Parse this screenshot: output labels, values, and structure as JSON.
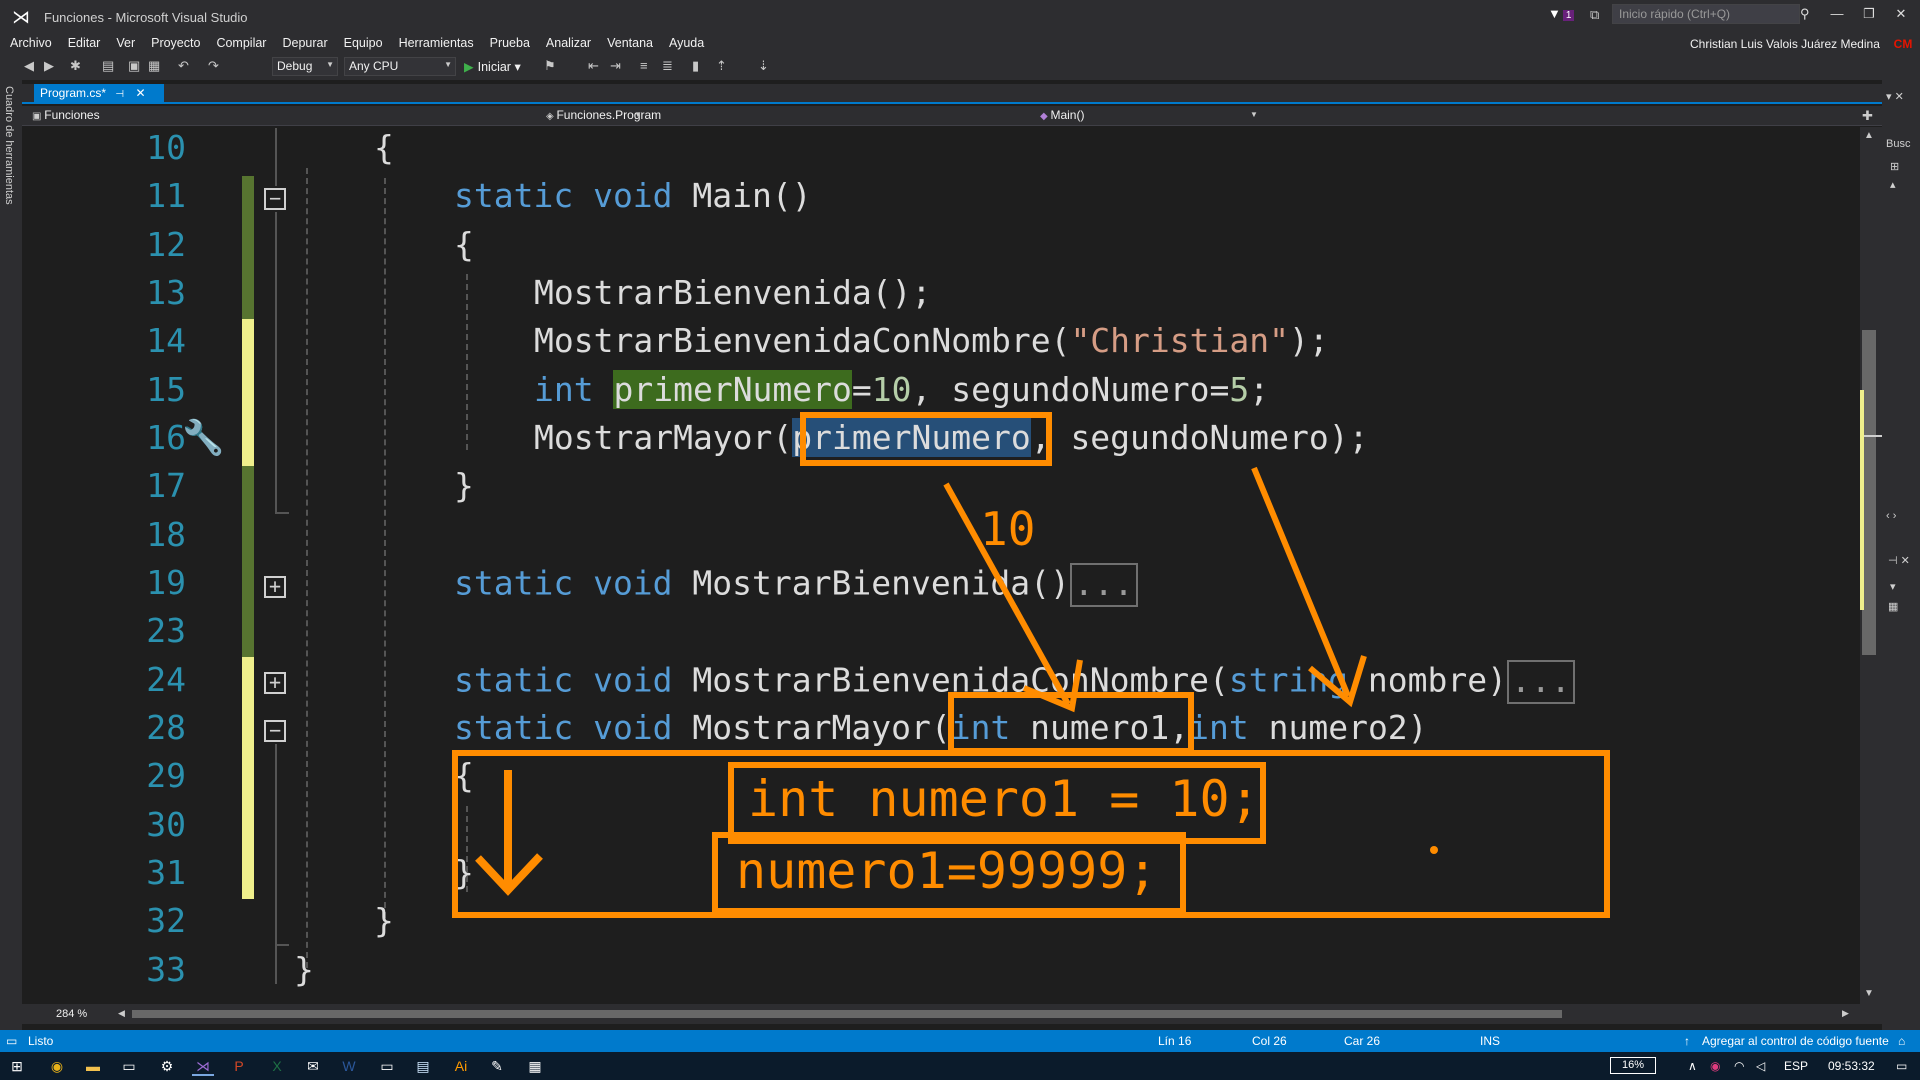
{
  "window": {
    "title": "Funciones - Microsoft Visual Studio",
    "notifications_count": "1",
    "quick_launch_placeholder": "Inicio rápido (Ctrl+Q)",
    "user_name": "Christian Luis Valois Juárez Medina",
    "user_initials": "CM"
  },
  "menu": [
    "Archivo",
    "Editar",
    "Ver",
    "Proyecto",
    "Compilar",
    "Depurar",
    "Equipo",
    "Herramientas",
    "Prueba",
    "Analizar",
    "Ventana",
    "Ayuda"
  ],
  "toolbar": {
    "configuration": "Debug",
    "platform": "Any CPU",
    "start_label": "Iniciar"
  },
  "side": {
    "toolbox_label": "Cuadro de herramientas",
    "search_label": "Busc"
  },
  "tab": {
    "label": "Program.cs*"
  },
  "nav": {
    "project": "Funciones",
    "class": "Funciones.Program",
    "member": "Main()"
  },
  "editor": {
    "line_numbers": [
      "10",
      "11",
      "12",
      "13",
      "14",
      "15",
      "16",
      "17",
      "18",
      "19",
      "23",
      "24",
      "28",
      "29",
      "30",
      "31",
      "32",
      "33"
    ],
    "code": {
      "l10": "{",
      "l11_kw": "static void",
      "l11_rest": " Main()",
      "l12": "{",
      "l13": "MostrarBienvenida();",
      "l14_a": "MostrarBienvenidaConNombre(",
      "l14_str": "\"Christian\"",
      "l14_b": ");",
      "l15_kw": "int",
      "l15_var": "primerNumero",
      "l15_eq": "=",
      "l15_num1": "10",
      "l15_mid": ", segundoNumero=",
      "l15_num2": "5",
      "l15_end": ";",
      "l16_a": "MostrarMayor(",
      "l16_sel": "primerNumero",
      "l16_b": ", segundoNumero);",
      "l17": "}",
      "l19_kw": "static void",
      "l19_rest": " MostrarBienvenida()",
      "l24_kw": "static void",
      "l24_rest": " MostrarBienvenidaConNombre(",
      "l24_kw2": "string",
      "l24_end": " nombre)",
      "l28_kw": "static void",
      "l28_rest": " MostrarMayor(",
      "l28_kw2": "int",
      "l28_p1": " numero1,",
      "l28_kw3": "int",
      "l28_p2": " numero2)",
      "l29": "{",
      "l31": "}",
      "l32": "}",
      "l33": "}",
      "ellipsis": "..."
    },
    "zoom": "284 %"
  },
  "annotations": {
    "value_label": "10",
    "assign_line": "int numero1 = 10;",
    "reassign_line": "numero1=99999;",
    "color": "#ff8c00"
  },
  "status": {
    "state": "Listo",
    "line": "Lín 16",
    "col": "Col 26",
    "char": "Car 26",
    "mode": "INS",
    "source_control": "Agregar al control de código fuente"
  },
  "taskbar": {
    "battery": "16%",
    "language": "ESP",
    "time": "09:53:32"
  }
}
